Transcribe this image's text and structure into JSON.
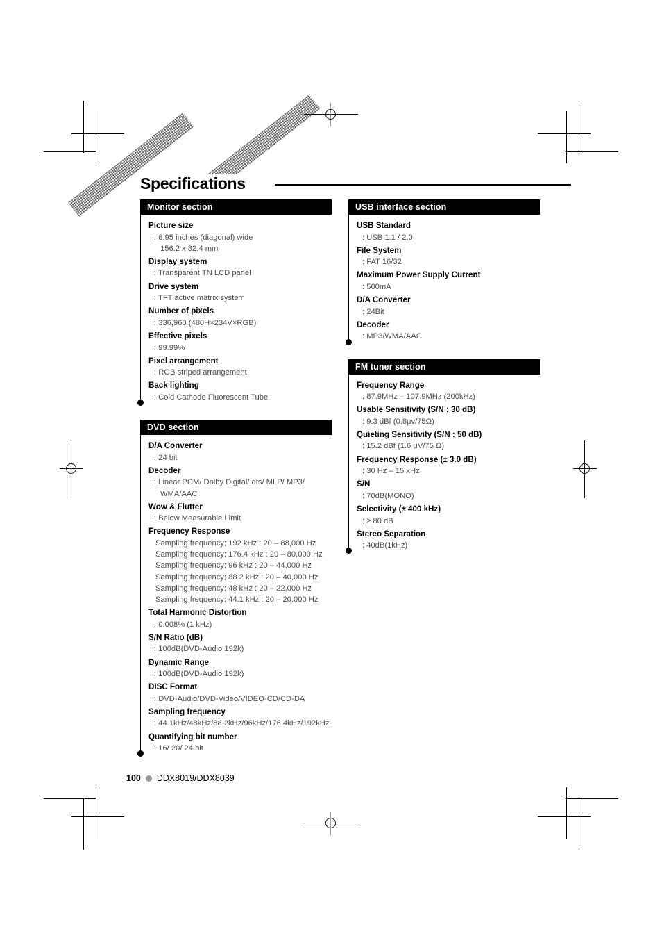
{
  "page": {
    "title": "Specifications",
    "footer": {
      "page_number": "100",
      "model": "DDX8019/DDX8039",
      "dot_color": "#9a9a9a"
    }
  },
  "columns": {
    "left": [
      {
        "id": "monitor-section",
        "heading": "Monitor section",
        "specs": [
          {
            "label": "Picture size",
            "values": [
              ": 6.95 inches (diagonal) wide",
              "156.2 x 82.4 mm"
            ]
          },
          {
            "label": "Display system",
            "values": [
              ": Transparent TN LCD panel"
            ]
          },
          {
            "label": "Drive system",
            "values": [
              ": TFT active matrix system"
            ]
          },
          {
            "label": "Number of pixels",
            "values": [
              ": 336,960 (480H×234V×RGB)"
            ]
          },
          {
            "label": "Effective pixels",
            "values": [
              ": 99.99%"
            ]
          },
          {
            "label": "Pixel arrangement",
            "values": [
              ": RGB striped arrangement"
            ]
          },
          {
            "label": "Back lighting",
            "values": [
              ": Cold Cathode Fluorescent Tube"
            ]
          }
        ]
      },
      {
        "id": "dvd-section",
        "heading": "DVD section",
        "specs": [
          {
            "label": "D/A Converter",
            "values": [
              ": 24 bit"
            ]
          },
          {
            "label": "Decoder",
            "values": [
              ": Linear PCM/ Dolby Digital/ dts/ MLP/ MP3/",
              "WMA/AAC"
            ]
          },
          {
            "label": "Wow & Flutter",
            "values": [
              ": Below Measurable Limit"
            ]
          },
          {
            "label": "Frequency Response",
            "values": [
              "Sampling frequency; 192 kHz : 20 – 88,000 Hz",
              "Sampling frequency; 176.4 kHz : 20 – 80,000 Hz",
              "Sampling frequency; 96 kHz : 20 – 44,000 Hz",
              "Sampling frequency; 88.2 kHz : 20 – 40,000 Hz",
              "Sampling frequency; 48 kHz : 20 – 22,000 Hz",
              "Sampling frequency; 44.1 kHz : 20 – 20,000 Hz"
            ],
            "plain": true
          },
          {
            "label": "Total Harmonic Distortion",
            "values": [
              ": 0.008% (1 kHz)"
            ]
          },
          {
            "label": "S/N Ratio (dB)",
            "values": [
              ": 100dB(DVD-Audio 192k)"
            ]
          },
          {
            "label": "Dynamic Range",
            "values": [
              ": 100dB(DVD-Audio 192k)"
            ]
          },
          {
            "label": "DISC Format",
            "values": [
              ": DVD-Audio/DVD-Video/VIDEO-CD/CD-DA"
            ]
          },
          {
            "label": "Sampling frequency",
            "values": [
              ": 44.1kHz/48kHz/88.2kHz/96kHz/176.4kHz/192kHz"
            ]
          },
          {
            "label": "Quantifying bit number",
            "values": [
              ": 16/ 20/ 24 bit"
            ]
          }
        ]
      }
    ],
    "right": [
      {
        "id": "usb-interface-section",
        "heading": "USB interface section",
        "specs": [
          {
            "label": "USB Standard",
            "values": [
              ": USB 1.1 / 2.0"
            ]
          },
          {
            "label": "File System",
            "values": [
              ": FAT 16/32"
            ]
          },
          {
            "label": "Maximum Power Supply Current",
            "values": [
              ": 500mA"
            ]
          },
          {
            "label": "D/A Converter",
            "values": [
              ": 24Bit"
            ]
          },
          {
            "label": "Decoder",
            "values": [
              ": MP3/WMA/AAC"
            ]
          }
        ]
      },
      {
        "id": "fm-tuner-section",
        "heading": "FM tuner section",
        "specs": [
          {
            "label": "Frequency Range",
            "values": [
              ": 87.9MHz – 107.9MHz (200kHz)"
            ]
          },
          {
            "label": "Usable Sensitivity (S/N : 30 dB)",
            "values": [
              ": 9.3 dBf (0.8μv/75Ω)"
            ]
          },
          {
            "label": "Quieting Sensitivity (S/N : 50 dB)",
            "values": [
              ": 15.2 dBf (1.6 μV/75 Ω)"
            ]
          },
          {
            "label": "Frequency Response (± 3.0 dB)",
            "values": [
              ": 30 Hz – 15 kHz"
            ]
          },
          {
            "label": "S/N",
            "values": [
              ": 70dB(MONO)"
            ]
          },
          {
            "label": "Selectivity (± 400 kHz)",
            "values": [
              ": ≥ 80 dB"
            ]
          },
          {
            "label": "Stereo Separation",
            "values": [
              ": 40dB(1kHz)"
            ]
          }
        ]
      }
    ]
  }
}
